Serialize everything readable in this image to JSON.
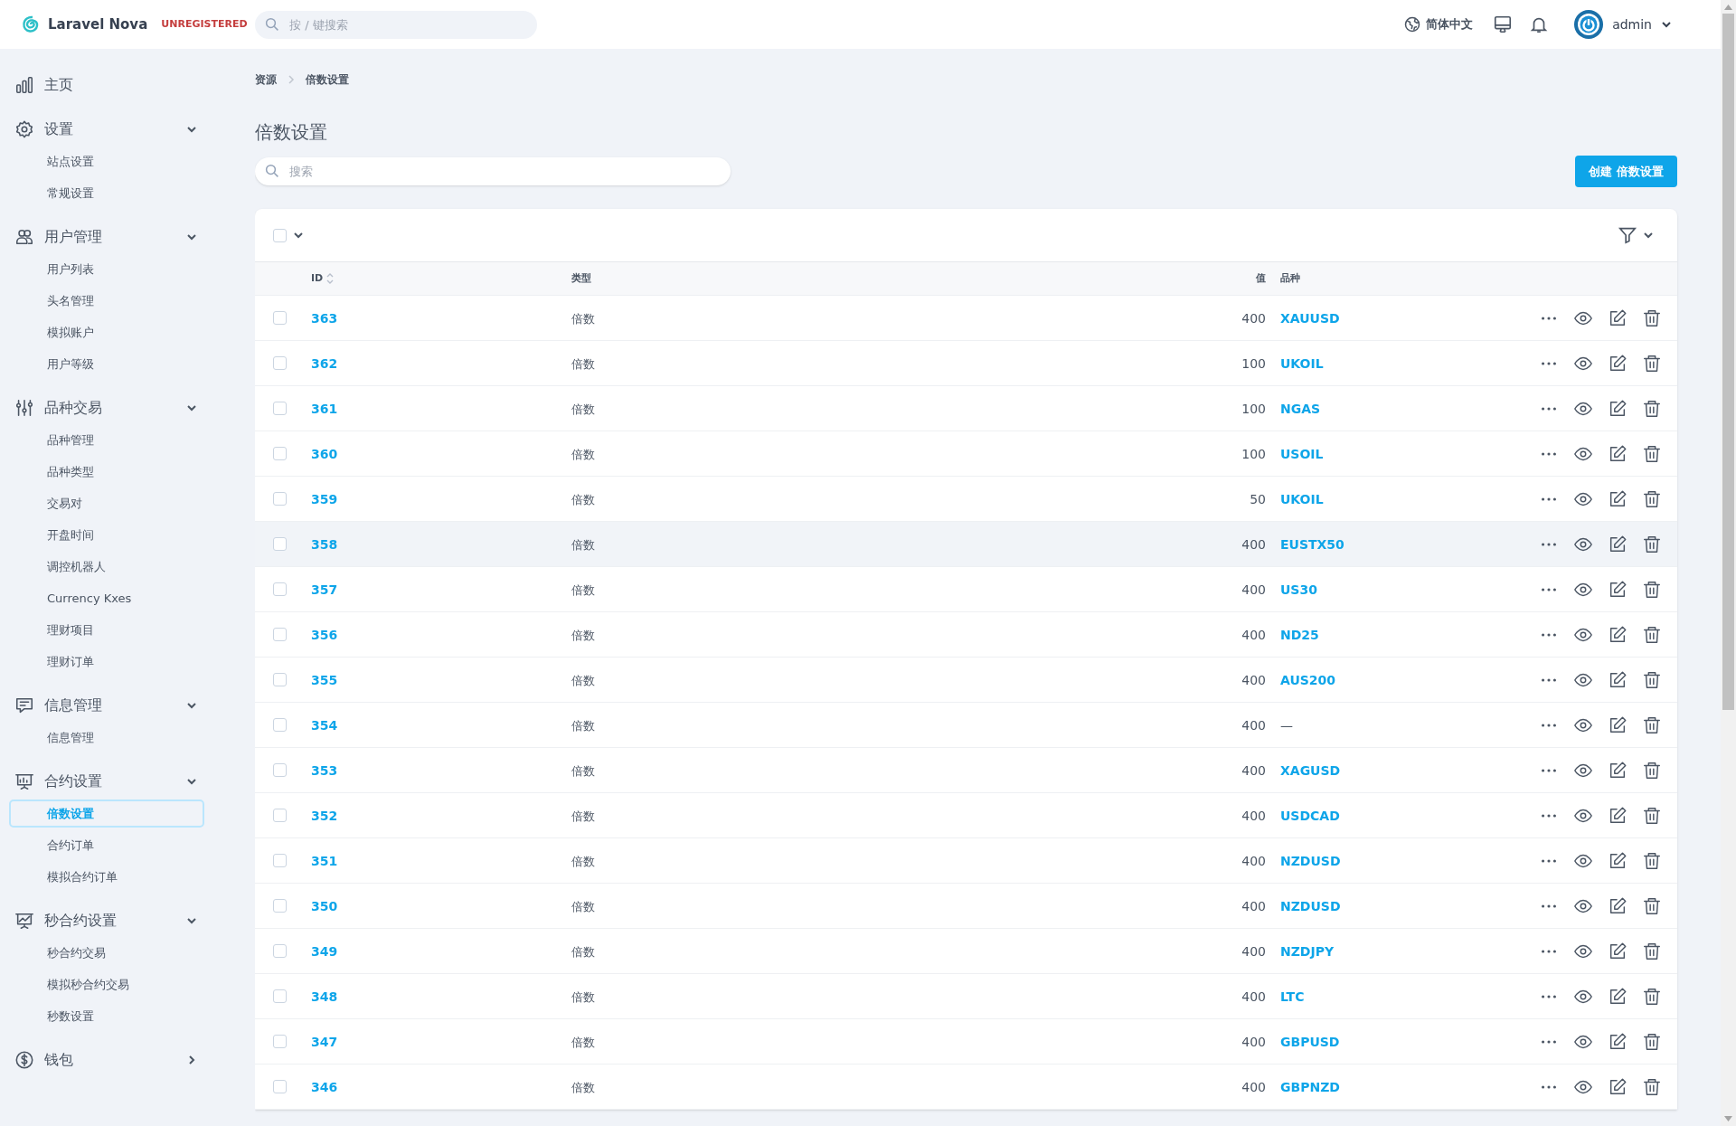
{
  "header": {
    "brand": "Laravel Nova",
    "badge": "UNREGISTERED",
    "search": {
      "placeholder": "按 / 键搜索"
    },
    "language": "简体中文",
    "user": "admin"
  },
  "sidebar": [
    {
      "label": "主页",
      "kind": "link"
    },
    {
      "label": "设置",
      "kind": "group",
      "expanded": true,
      "children": [
        {
          "label": "站点设置",
          "selected": false
        },
        {
          "label": "常规设置",
          "selected": false
        }
      ]
    },
    {
      "label": "用户管理",
      "kind": "group",
      "expanded": true,
      "children": [
        {
          "label": "用户列表",
          "selected": false
        },
        {
          "label": "头名管理",
          "selected": false
        },
        {
          "label": "模拟账户",
          "selected": false
        },
        {
          "label": "用户等级",
          "selected": false
        }
      ]
    },
    {
      "label": "品种交易",
      "kind": "group",
      "expanded": true,
      "children": [
        {
          "label": "品种管理",
          "selected": false
        },
        {
          "label": "品种类型",
          "selected": false
        },
        {
          "label": "交易对",
          "selected": false
        },
        {
          "label": "开盘时间",
          "selected": false
        },
        {
          "label": "调控机器人",
          "selected": false
        },
        {
          "label": "Currency Kxes",
          "selected": false
        },
        {
          "label": "理财项目",
          "selected": false
        },
        {
          "label": "理财订单",
          "selected": false
        }
      ]
    },
    {
      "label": "信息管理",
      "kind": "group",
      "expanded": true,
      "children": [
        {
          "label": "信息管理",
          "selected": false
        }
      ]
    },
    {
      "label": "合约设置",
      "kind": "group",
      "expanded": true,
      "children": [
        {
          "label": "倍数设置",
          "selected": true
        },
        {
          "label": "合约订单",
          "selected": false
        },
        {
          "label": "模拟合约订单",
          "selected": false
        }
      ]
    },
    {
      "label": "秒合约设置",
      "kind": "group",
      "expanded": true,
      "children": [
        {
          "label": "秒合约交易",
          "selected": false
        },
        {
          "label": "模拟秒合约交易",
          "selected": false
        },
        {
          "label": "秒数设置",
          "selected": false
        }
      ]
    },
    {
      "label": "钱包",
      "kind": "group",
      "expanded": false
    }
  ],
  "breadcrumbs": [
    "资源",
    "倍数设置"
  ],
  "title": "倍数设置",
  "search": {
    "placeholder": "搜索"
  },
  "create_button": "创建 倍数设置",
  "table": {
    "select_all": {
      "checked": false
    },
    "columns": [
      "ID",
      "类型",
      "值",
      "品种"
    ],
    "rows": [
      {
        "id": "363",
        "type": "倍数",
        "value": "400",
        "symbol": "XAUUSD",
        "symbol_link": true,
        "checked": false,
        "hovered": false
      },
      {
        "id": "362",
        "type": "倍数",
        "value": "100",
        "symbol": "UKOIL",
        "symbol_link": true,
        "checked": false,
        "hovered": false
      },
      {
        "id": "361",
        "type": "倍数",
        "value": "100",
        "symbol": "NGAS",
        "symbol_link": true,
        "checked": false,
        "hovered": false
      },
      {
        "id": "360",
        "type": "倍数",
        "value": "100",
        "symbol": "USOIL",
        "symbol_link": true,
        "checked": false,
        "hovered": false
      },
      {
        "id": "359",
        "type": "倍数",
        "value": "50",
        "symbol": "UKOIL",
        "symbol_link": true,
        "checked": false,
        "hovered": false
      },
      {
        "id": "358",
        "type": "倍数",
        "value": "400",
        "symbol": "EUSTX50",
        "symbol_link": true,
        "checked": false,
        "hovered": true
      },
      {
        "id": "357",
        "type": "倍数",
        "value": "400",
        "symbol": "US30",
        "symbol_link": true,
        "checked": false,
        "hovered": false
      },
      {
        "id": "356",
        "type": "倍数",
        "value": "400",
        "symbol": "ND25",
        "symbol_link": true,
        "checked": false,
        "hovered": false
      },
      {
        "id": "355",
        "type": "倍数",
        "value": "400",
        "symbol": "AUS200",
        "symbol_link": true,
        "checked": false,
        "hovered": false
      },
      {
        "id": "354",
        "type": "倍数",
        "value": "400",
        "symbol": "—",
        "symbol_link": false,
        "checked": false,
        "hovered": false
      },
      {
        "id": "353",
        "type": "倍数",
        "value": "400",
        "symbol": "XAGUSD",
        "symbol_link": true,
        "checked": false,
        "hovered": false
      },
      {
        "id": "352",
        "type": "倍数",
        "value": "400",
        "symbol": "USDCAD",
        "symbol_link": true,
        "checked": false,
        "hovered": false
      },
      {
        "id": "351",
        "type": "倍数",
        "value": "400",
        "symbol": "NZDUSD",
        "symbol_link": true,
        "checked": false,
        "hovered": false
      },
      {
        "id": "350",
        "type": "倍数",
        "value": "400",
        "symbol": "NZDUSD",
        "symbol_link": true,
        "checked": false,
        "hovered": false
      },
      {
        "id": "349",
        "type": "倍数",
        "value": "400",
        "symbol": "NZDJPY",
        "symbol_link": true,
        "checked": false,
        "hovered": false
      },
      {
        "id": "348",
        "type": "倍数",
        "value": "400",
        "symbol": "LTC",
        "symbol_link": true,
        "checked": false,
        "hovered": false
      },
      {
        "id": "347",
        "type": "倍数",
        "value": "400",
        "symbol": "GBPUSD",
        "symbol_link": true,
        "checked": false,
        "hovered": false
      },
      {
        "id": "346",
        "type": "倍数",
        "value": "400",
        "symbol": "GBPNZD",
        "symbol_link": true,
        "checked": false,
        "hovered": false
      }
    ]
  }
}
